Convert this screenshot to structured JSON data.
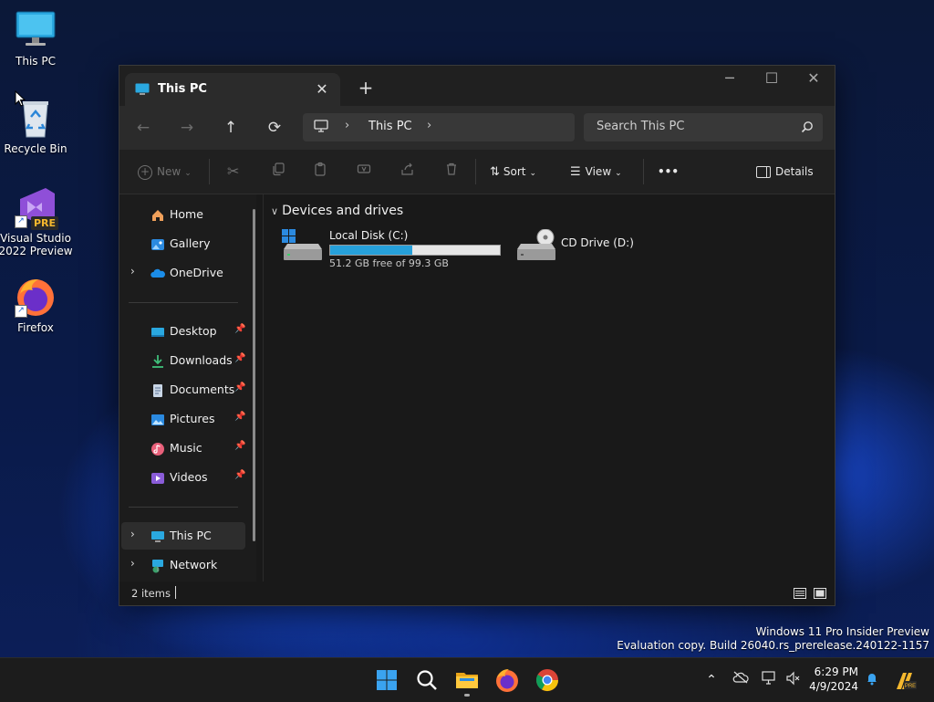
{
  "desktop": {
    "icons": [
      {
        "label": "This PC",
        "icon": "monitor-icon"
      },
      {
        "label": "Recycle Bin",
        "icon": "recycle-bin-icon"
      },
      {
        "label": "Visual Studio 2022 Preview",
        "icon": "visual-studio-icon",
        "badge": "PRE"
      },
      {
        "label": "Firefox",
        "icon": "firefox-icon"
      }
    ]
  },
  "window": {
    "tab_title": "This PC",
    "address": {
      "location": "This PC"
    },
    "search": {
      "placeholder": "Search This PC"
    },
    "toolbar": {
      "new_label": "New",
      "sort_label": "Sort",
      "view_label": "View",
      "more_label": "•••",
      "details_label": "Details"
    },
    "sidebar": {
      "items": [
        {
          "label": "Home",
          "icon": "home-icon"
        },
        {
          "label": "Gallery",
          "icon": "gallery-icon"
        },
        {
          "label": "OneDrive",
          "icon": "onedrive-icon"
        },
        {
          "label": "Desktop",
          "icon": "desktop-folder-icon"
        },
        {
          "label": "Downloads",
          "icon": "downloads-icon"
        },
        {
          "label": "Documents",
          "icon": "documents-icon"
        },
        {
          "label": "Pictures",
          "icon": "pictures-icon"
        },
        {
          "label": "Music",
          "icon": "music-icon"
        },
        {
          "label": "Videos",
          "icon": "videos-icon"
        },
        {
          "label": "This PC",
          "icon": "this-pc-icon"
        },
        {
          "label": "Network",
          "icon": "network-icon"
        }
      ]
    },
    "content": {
      "group_title": "Devices and drives",
      "drives": [
        {
          "name": "Local Disk (C:)",
          "free_text": "51.2 GB free of 99.3 GB",
          "used_fraction": 0.484
        },
        {
          "name": "CD Drive (D:)"
        }
      ]
    },
    "status": {
      "items_text": "2 items"
    }
  },
  "watermark": {
    "line1": "Windows 11 Pro Insider Preview",
    "line2": "Evaluation copy. Build 26040.rs_prerelease.240122-1157"
  },
  "taskbar": {
    "clock_time": "6:29 PM",
    "clock_date": "4/9/2024"
  },
  "colors": {
    "accent": "#26a0da",
    "window_bg": "#191919",
    "toolbar_bg": "#202020"
  }
}
